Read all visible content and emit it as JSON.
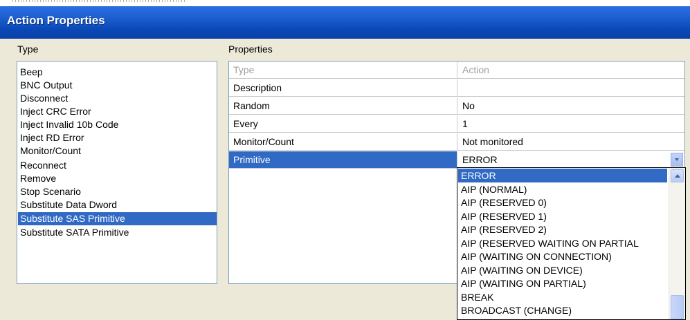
{
  "window": {
    "title": "Action Properties"
  },
  "type_panel": {
    "label": "Type",
    "items": [
      "Beep",
      "BNC Output",
      "Disconnect",
      "Inject CRC Error",
      "Inject Invalid 10b Code",
      "Inject RD Error",
      "Monitor/Count",
      "Reconnect",
      "Remove",
      "Stop Scenario",
      "Substitute Data Dword",
      "Substitute SAS Primitive",
      "Substitute SATA Primitive"
    ],
    "selected": "Substitute SAS Primitive"
  },
  "properties_panel": {
    "label": "Properties",
    "rows": [
      {
        "key": "Type",
        "value": "Action"
      },
      {
        "key": "Description",
        "value": ""
      },
      {
        "key": "Random",
        "value": "No"
      },
      {
        "key": "Every",
        "value": "1"
      },
      {
        "key": "Monitor/Count",
        "value": "Not monitored"
      },
      {
        "key": "Primitive",
        "value": "ERROR"
      }
    ],
    "selected_row": "Primitive"
  },
  "primitive_dropdown": {
    "selected": "ERROR",
    "options": [
      "ERROR",
      "AIP (NORMAL)",
      "AIP (RESERVED 0)",
      "AIP (RESERVED 1)",
      "AIP (RESERVED 2)",
      "AIP (RESERVED WAITING ON PARTIAL",
      "AIP (WAITING ON CONNECTION)",
      "AIP (WAITING ON DEVICE)",
      "AIP (WAITING ON PARTIAL)",
      "BREAK",
      "BROADCAST (CHANGE)"
    ]
  },
  "colors": {
    "titlebar": "#0b49b8",
    "selection": "#316ac5",
    "dialog_bg": "#ece9d8"
  }
}
